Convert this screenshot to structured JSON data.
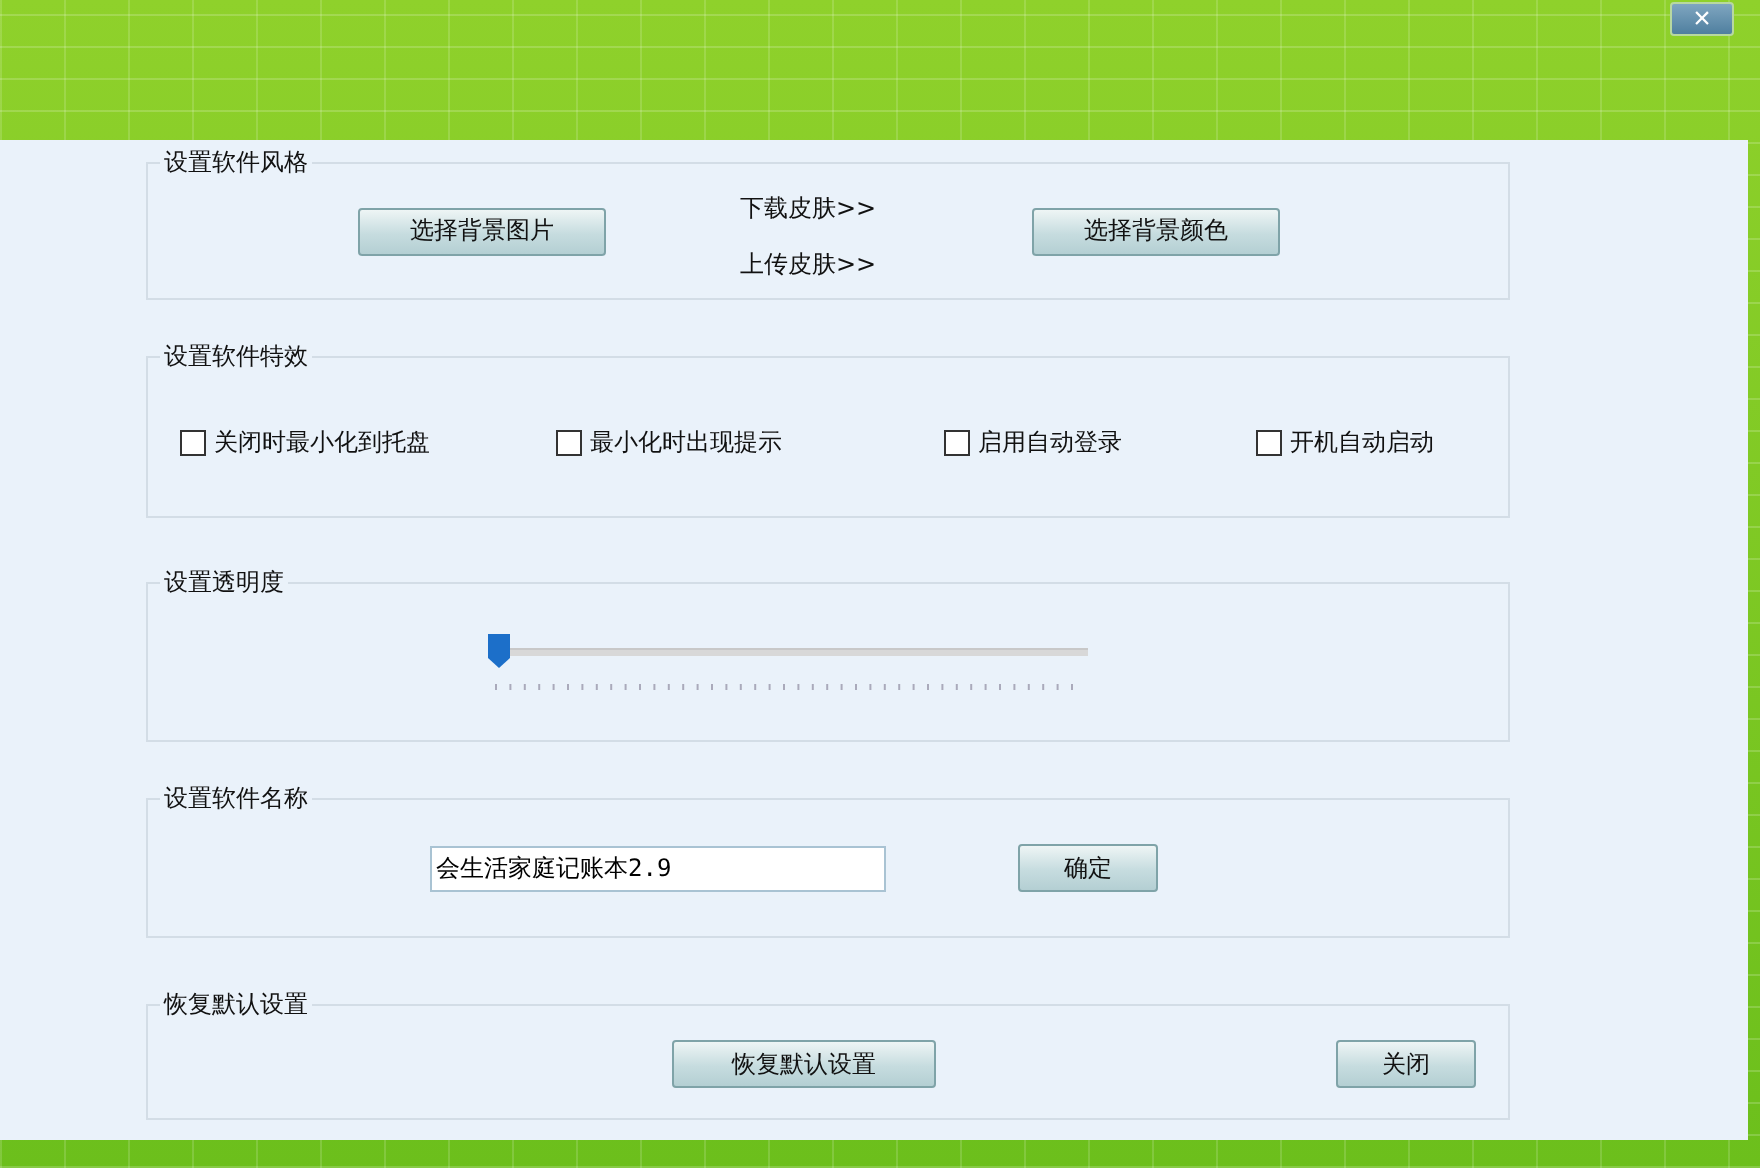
{
  "window": {
    "close_glyph": "×"
  },
  "groups": [
    {
      "title": "设置软件风格",
      "kind": "style",
      "buttons": [
        "选择背景图片",
        "选择背景颜色"
      ],
      "links": [
        "下载皮肤>>",
        "上传皮肤>>"
      ]
    },
    {
      "title": "设置软件特效",
      "kind": "checks",
      "checkboxes": [
        {
          "label": "关闭时最小化到托盘",
          "checked": false
        },
        {
          "label": "最小化时出现提示",
          "checked": false
        },
        {
          "label": "启用自动登录",
          "checked": false
        },
        {
          "label": "开机自动启动",
          "checked": false
        }
      ]
    },
    {
      "title": "设置透明度",
      "kind": "slider",
      "slider": {
        "level": 0
      }
    },
    {
      "title": "设置软件名称",
      "kind": "name",
      "input": {
        "value": "会生活家庭记账本2.9"
      },
      "buttons": [
        "确定"
      ]
    },
    {
      "title": "恢复默认设置",
      "kind": "reset",
      "buttons": [
        "恢复默认设置",
        "关闭"
      ]
    }
  ]
}
